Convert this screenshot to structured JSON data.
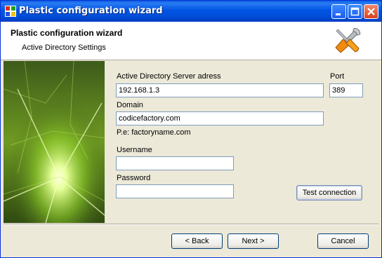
{
  "window": {
    "title": "Plastic configuration wizard"
  },
  "header": {
    "title": "Plastic configuration wizard",
    "subtitle": "Active Directory Settings"
  },
  "form": {
    "server_label": "Active Directory Server adress",
    "server_value": "192.168.1.3",
    "port_label": "Port",
    "port_value": "389",
    "domain_label": "Domain",
    "domain_value": "codicefactory.com",
    "domain_hint": "P.e: factoryname.com",
    "username_label": "Username",
    "username_value": "",
    "password_label": "Password",
    "password_value": "",
    "test_button": "Test connection"
  },
  "footer": {
    "back_button": "< Back",
    "next_button": "Next >",
    "cancel_button": "Cancel"
  },
  "icons": {
    "app": "app-icon",
    "tools": "wrench-screwdriver-icon",
    "minimize": "minimize-icon",
    "maximize": "maximize-icon",
    "close": "close-icon"
  },
  "colors": {
    "titlebar": "#0054e3",
    "dialog_bg": "#ece9d8",
    "header_bg": "#ffffff",
    "field_border": "#7f9db9",
    "side_image_green": "#8fcf2a"
  }
}
